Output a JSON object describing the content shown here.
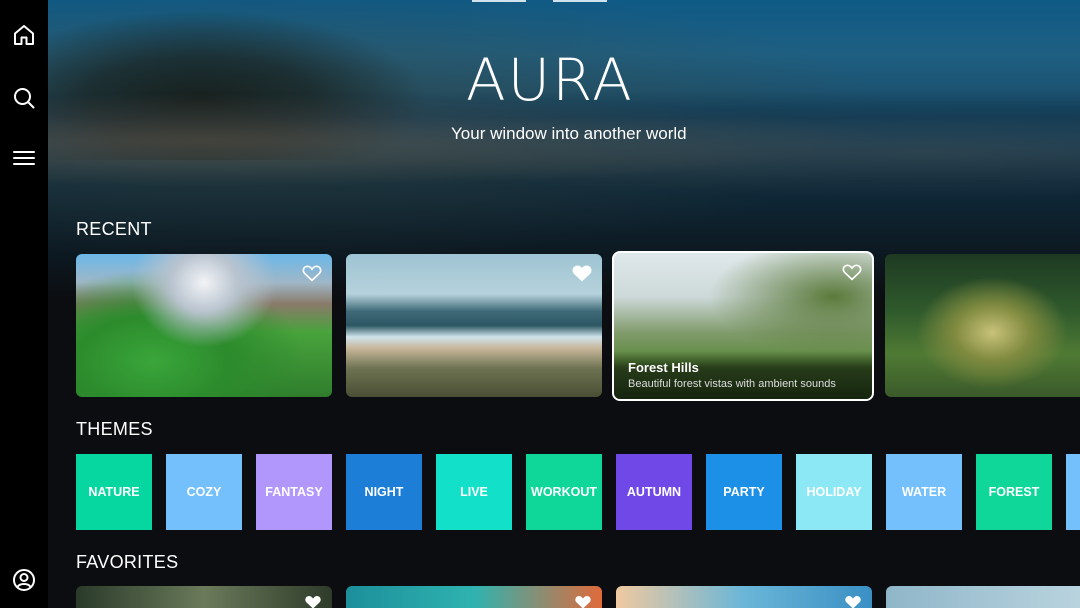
{
  "app": {
    "logo": "AURA",
    "tagline": "Your window into another world"
  },
  "sidebar": {
    "items": [
      {
        "icon": "home-icon"
      },
      {
        "icon": "search-icon"
      },
      {
        "icon": "menu-icon"
      },
      {
        "icon": "account-icon"
      }
    ]
  },
  "sections": {
    "recent": "RECENT",
    "themes": "THEMES",
    "favorites": "FAVORITES"
  },
  "recent": {
    "items": [
      {
        "scene": "fantasy mountain valley"
      },
      {
        "scene": "coastal beach"
      },
      {
        "title": "Forest Hills",
        "subtitle": "Beautiful forest vistas with ambient sounds",
        "selected": true
      },
      {
        "scene": "sunlit forest"
      }
    ]
  },
  "themes": {
    "items": [
      {
        "label": "NATURE",
        "color": "#06d6a0"
      },
      {
        "label": "COZY",
        "color": "#74c0fc"
      },
      {
        "label": "FANTASY",
        "color": "#b197fc"
      },
      {
        "label": "NIGHT",
        "color": "#1c7ed6"
      },
      {
        "label": "LIVE",
        "color": "#12e0c8"
      },
      {
        "label": "WORKOUT",
        "color": "#0fd699"
      },
      {
        "label": "AUTUMN",
        "color": "#7048e8"
      },
      {
        "label": "PARTY",
        "color": "#1c8fe6"
      },
      {
        "label": "HOLIDAY",
        "color": "#8de8f5"
      },
      {
        "label": "WATER",
        "color": "#74c0fc"
      },
      {
        "label": "FOREST",
        "color": "#0fd699"
      },
      {
        "label": "",
        "color": "#74c0fc"
      }
    ]
  }
}
